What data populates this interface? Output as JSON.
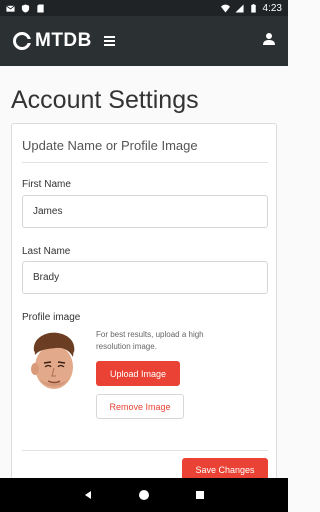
{
  "status_bar": {
    "time": "4:23",
    "left_icons": [
      "mail-icon",
      "shield-icon",
      "sd-card-icon"
    ],
    "right_icons": [
      "wifi-icon",
      "signal-icon",
      "battery-icon"
    ]
  },
  "app_bar": {
    "logo_text": "MTDB",
    "menu_icon": "hamburger-icon",
    "user_icon": "person-icon"
  },
  "page": {
    "title": "Account Settings"
  },
  "card": {
    "title": "Update Name or Profile Image",
    "first_name_label": "First Name",
    "first_name_value": "James",
    "last_name_label": "Last Name",
    "last_name_value": "Brady",
    "profile_image_label": "Profile image",
    "hint": "For best results, upload a high resolution image.",
    "upload_button": "Upload Image",
    "remove_button": "Remove Image",
    "save_button": "Save Changes"
  },
  "colors": {
    "accent": "#ea4335",
    "app_bar": "#2b3033"
  }
}
